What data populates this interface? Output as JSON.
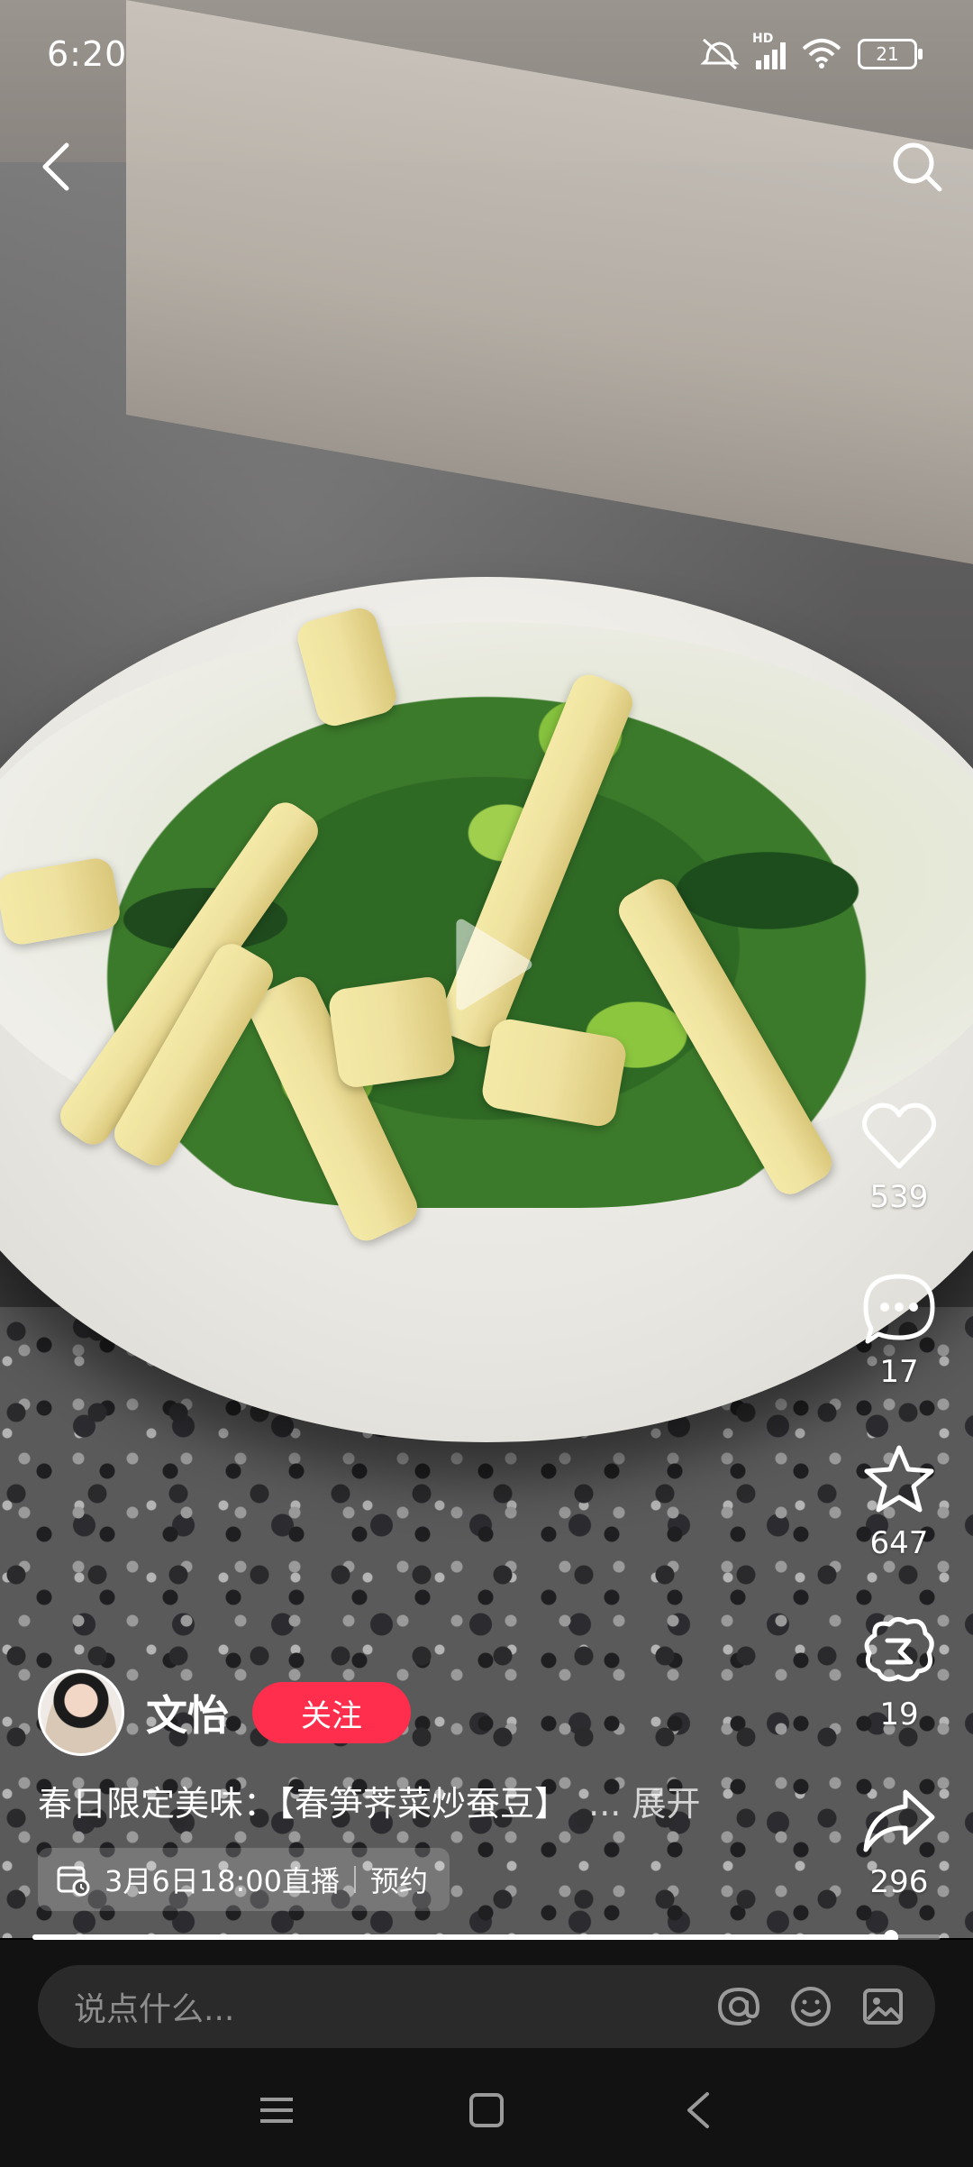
{
  "status_bar": {
    "time": "6:20",
    "battery": "21",
    "network": "HD"
  },
  "top_nav": {
    "back_icon": "chevron-left-icon",
    "search_icon": "search-icon"
  },
  "post": {
    "author": "文怡",
    "follow_label": "关注",
    "caption": "春日限定美味：【春笋荠菜炒蚕豆】",
    "caption_ellipsis": "...",
    "caption_more": "展开",
    "live_schedule": "3月6日18:00直播",
    "reserve_label": "预约",
    "progress": 0.945
  },
  "actions": [
    {
      "name": "like",
      "icon": "heart-icon",
      "count": "539"
    },
    {
      "name": "comment",
      "icon": "comment-bubble-icon",
      "count": "17"
    },
    {
      "name": "favorite",
      "icon": "star-icon",
      "count": "647"
    },
    {
      "name": "share-moments",
      "icon": "moments-icon",
      "count": "19"
    },
    {
      "name": "share",
      "icon": "share-arrow-icon",
      "count": "296"
    }
  ],
  "comment_bar": {
    "placeholder": "说点什么..."
  },
  "colors": {
    "follow": "#ff2e4d",
    "background": "#121212"
  }
}
